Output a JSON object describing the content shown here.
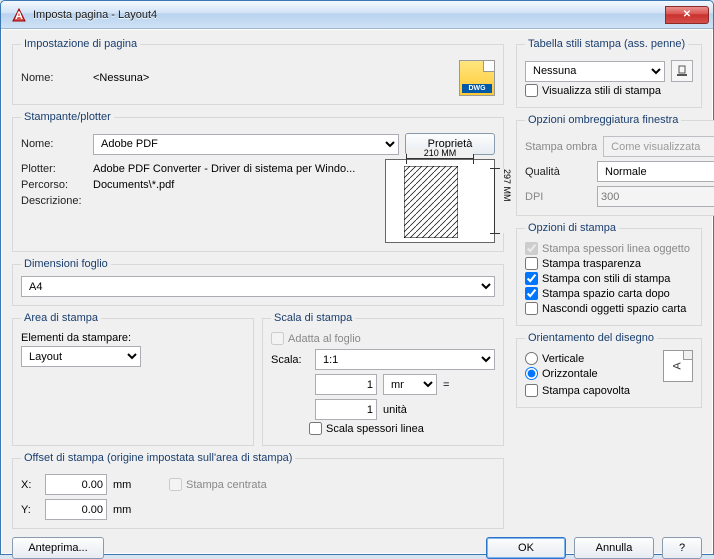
{
  "title": "Imposta pagina - Layout4",
  "pageSettings": {
    "legend": "Impostazione di pagina",
    "nameLabel": "Nome:",
    "name": "<Nessuna>",
    "dwgTag": "DWG"
  },
  "printer": {
    "legend": "Stampante/plotter",
    "nameLabel": "Nome:",
    "name": "Adobe PDF",
    "propertiesBtn": "Proprietà",
    "plotterLabel": "Plotter:",
    "plotter": "Adobe PDF Converter - Driver di sistema per Windo...",
    "pathLabel": "Percorso:",
    "path": "Documents\\*.pdf",
    "descLabel": "Descrizione:",
    "paperW": "210 MM",
    "paperH": "297 MM"
  },
  "paperSize": {
    "legend": "Dimensioni foglio",
    "value": "A4"
  },
  "plotArea": {
    "legend": "Area di stampa",
    "whatLabel": "Elementi da stampare:",
    "value": "Layout"
  },
  "scale": {
    "legend": "Scala di stampa",
    "fitLabel": "Adatta al foglio",
    "scaleLabel": "Scala:",
    "ratio": "1:1",
    "in1": "1",
    "unitSel": "mm",
    "equals": "=",
    "in2": "1",
    "unit2": "unità",
    "lwLabel": "Scala spessori linea"
  },
  "offset": {
    "legend": "Offset di stampa (origine impostata sull'area di stampa)",
    "xLabel": "X:",
    "x": "0.00",
    "yLabel": "Y:",
    "y": "0.00",
    "unit": "mm",
    "centerLabel": "Stampa centrata"
  },
  "styleTable": {
    "legend": "Tabella stili stampa (ass. penne)",
    "value": "Nessuna",
    "displayLabel": "Visualizza stili di stampa"
  },
  "shaded": {
    "legend": "Opzioni ombreggiatura finestra",
    "shadeLabel": "Stampa ombra",
    "shadeVal": "Come visualizzata",
    "qualityLabel": "Qualità",
    "qualityVal": "Normale",
    "dpiLabel": "DPI",
    "dpiVal": "300"
  },
  "options": {
    "legend": "Opzioni di stampa",
    "lw": "Stampa spessori linea oggetto",
    "trans": "Stampa trasparenza",
    "styles": "Stampa con stili di stampa",
    "last": "Stampa spazio carta dopo",
    "hide": "Nascondi oggetti spazio carta"
  },
  "orient": {
    "legend": "Orientamento del disegno",
    "portrait": "Verticale",
    "landscape": "Orizzontale",
    "upside": "Stampa capovolta"
  },
  "buttons": {
    "preview": "Anteprima...",
    "ok": "OK",
    "cancel": "Annulla",
    "help": "?"
  }
}
